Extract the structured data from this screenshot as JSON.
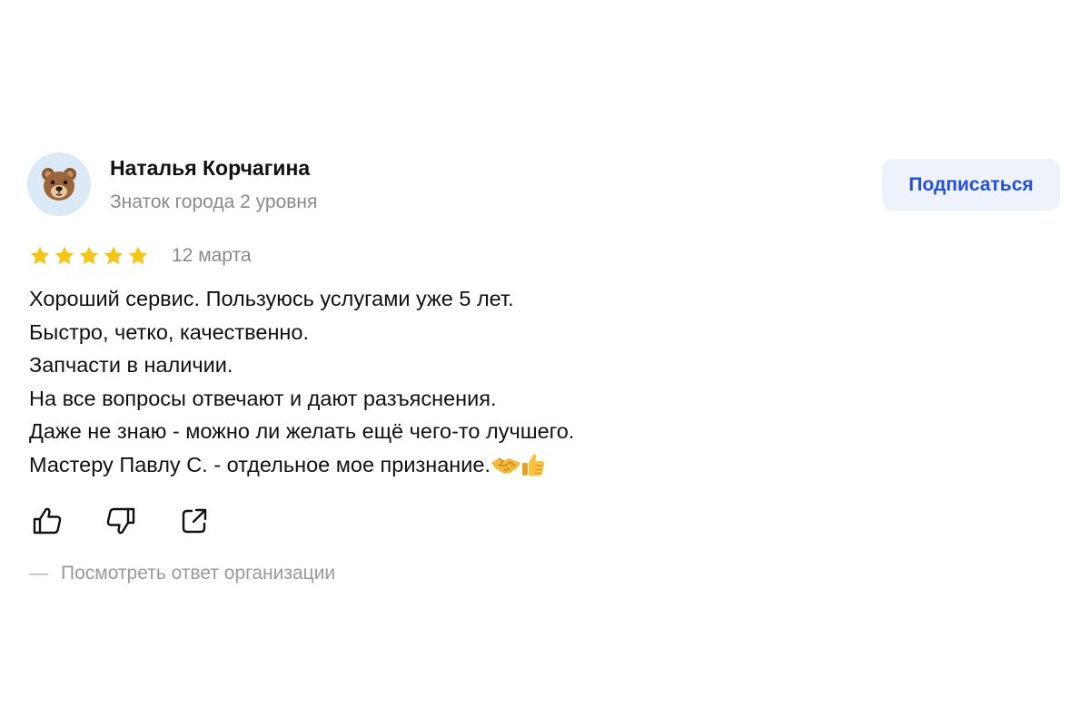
{
  "author": {
    "name": "Наталья Корчагина",
    "level": "Знаток города 2 уровня",
    "avatar_icon": "bear-face-icon"
  },
  "subscribe": {
    "label": "Подписаться"
  },
  "rating": {
    "stars": 5,
    "max": 5,
    "color": "#f5c518"
  },
  "date": "12 марта",
  "review": {
    "lines": [
      "Хороший сервис. Пользуюсь услугами уже 5 лет.",
      "Быстро, четко, качественно.",
      "Запчасти в наличии.",
      "На все вопросы отвечают и дают разъяснения.",
      "Даже не знаю - можно ли желать ещё чего-то лучшего.",
      "Мастеру Павлу С. - отдельное мое признание."
    ],
    "trailing_emoji": [
      "handshake-icon",
      "thumbs-up-icon"
    ]
  },
  "actions": {
    "like_icon": "thumbs-up-outline-icon",
    "dislike_icon": "thumbs-down-outline-icon",
    "share_icon": "share-icon"
  },
  "org_reply": {
    "dash": "—",
    "label": "Посмотреть ответ организации"
  },
  "colors": {
    "accent": "#2350d6",
    "button_bg": "#eef3fb",
    "muted": "#8a8a8a",
    "star": "#f5c518"
  }
}
